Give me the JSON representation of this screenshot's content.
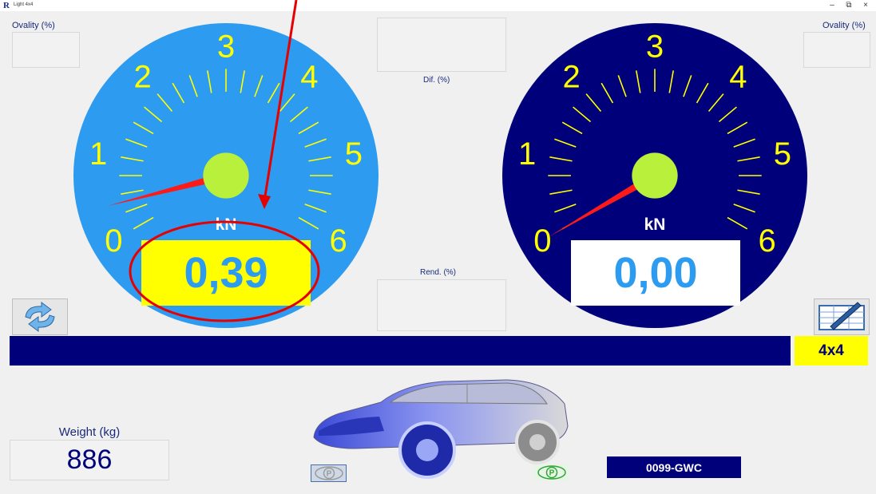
{
  "window": {
    "title": "Light 4x4",
    "minimize": "–",
    "restore": "⧉",
    "close": "×"
  },
  "left_panel": {
    "ovality_label": "Ovality (%)"
  },
  "right_panel": {
    "ovality_label": "Ovality (%)"
  },
  "center": {
    "dif_label": "Dif. (%)",
    "rend_label": "Rend. (%)"
  },
  "gauge_left": {
    "unit": "kN",
    "readout": "0,39",
    "value": 0.39,
    "scale": [
      "0",
      "1",
      "2",
      "3",
      "4",
      "5",
      "6"
    ],
    "face_color": "#2d9bf0",
    "readout_bg": "#ffff00",
    "readout_color": "#2d9bf0"
  },
  "gauge_right": {
    "unit": "kN",
    "readout": "0,00",
    "value": 0.0,
    "scale": [
      "0",
      "1",
      "2",
      "3",
      "4",
      "5",
      "6"
    ],
    "face_color": "#00007a",
    "readout_bg": "#ffffff",
    "readout_color": "#2d9bf0"
  },
  "mode_badge": "4x4",
  "weight": {
    "label": "Weight (kg)",
    "value": "886"
  },
  "plate": "0099-GWC",
  "icons": {
    "refresh": "refresh-arrows-icon",
    "report": "pen-table-icon",
    "car": "suv-car-image",
    "parking_left": "parking-brake-icon",
    "parking_right": "parking-brake-icon"
  },
  "colors": {
    "accent_yellow": "#ffff00",
    "dark_blue": "#00007a",
    "light_blue": "#2d9bf0",
    "needle_red": "#ff1a1a",
    "hub_green": "#b8f03c",
    "annotation_red": "#e60000"
  }
}
